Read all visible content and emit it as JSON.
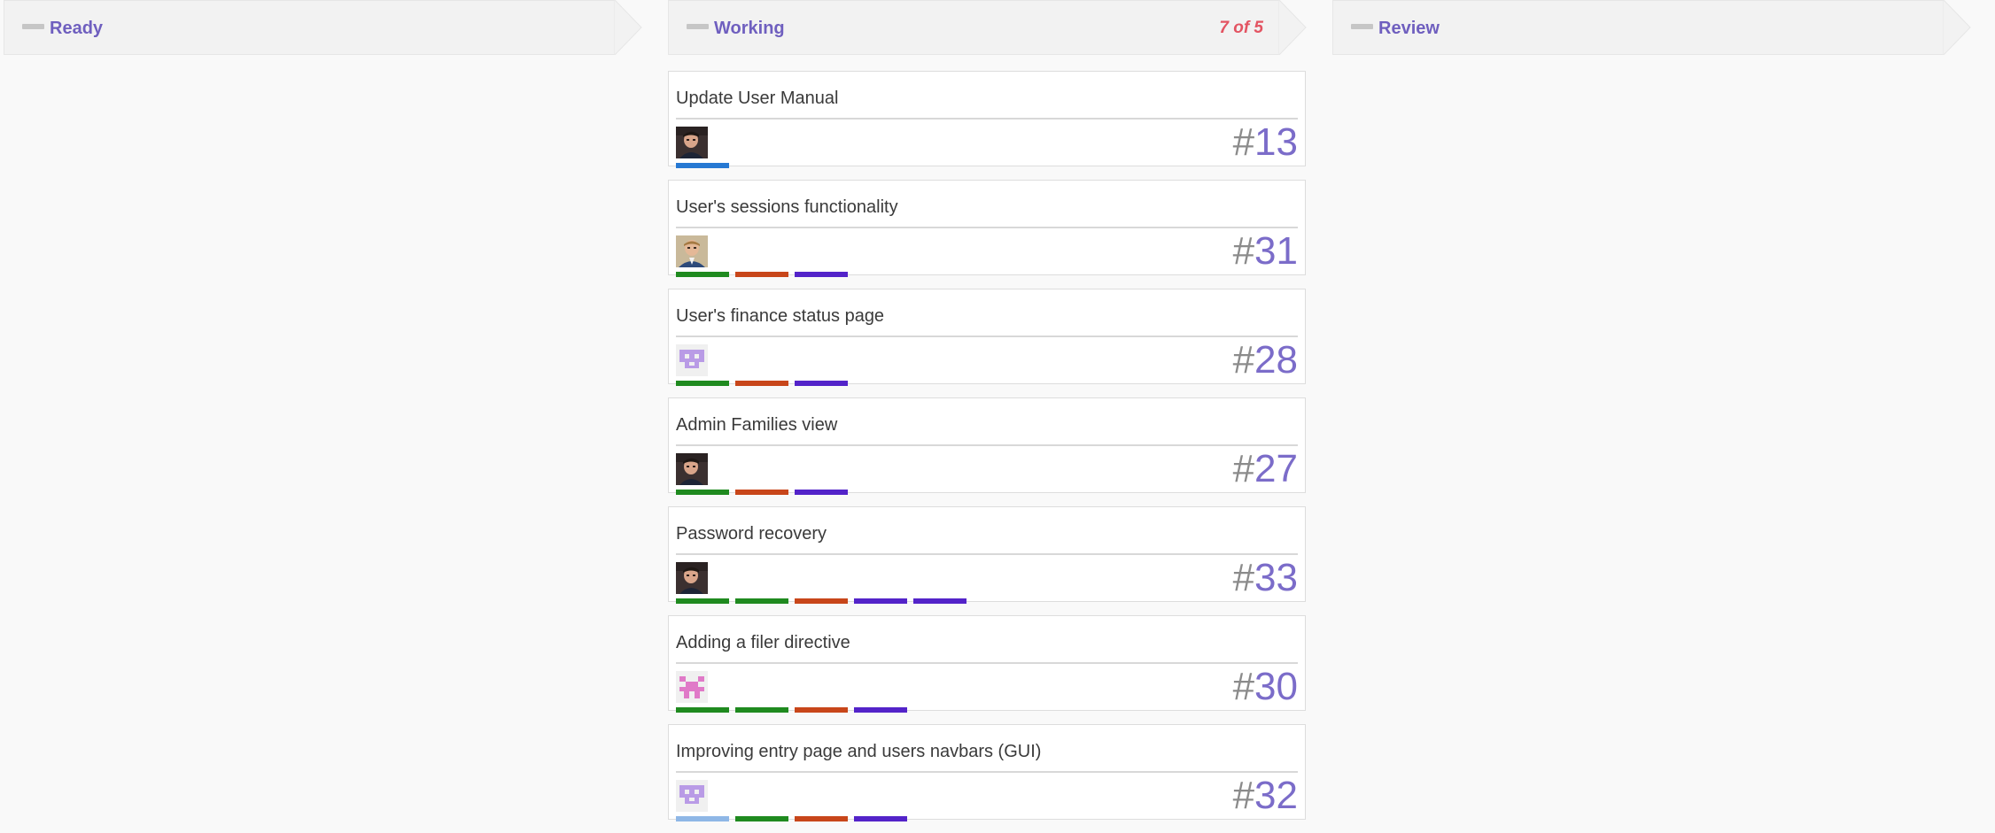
{
  "columns": [
    {
      "title": "Ready",
      "count": ""
    },
    {
      "title": "Working",
      "count": "7 of 5"
    },
    {
      "title": "Review",
      "count": ""
    }
  ],
  "colors": {
    "green": "#1f8a1f",
    "orange": "#c8461a",
    "purple": "#5323c9",
    "blue": "#2779d3",
    "lightblue": "#8fb7e6",
    "accent": "#6f5fbf",
    "count": "#e35462"
  },
  "cards": [
    {
      "title": "Update User Manual",
      "hash": "#",
      "number": "13",
      "avatar": "photo-man-dark",
      "tags": [
        "blue"
      ]
    },
    {
      "title": "User's sessions functionality",
      "hash": "#",
      "number": "31",
      "avatar": "photo-man-light",
      "tags": [
        "green",
        "orange",
        "purple"
      ]
    },
    {
      "title": "User's finance status page",
      "hash": "#",
      "number": "28",
      "avatar": "identicon-purple",
      "tags": [
        "green",
        "orange",
        "purple"
      ]
    },
    {
      "title": "Admin Families view",
      "hash": "#",
      "number": "27",
      "avatar": "photo-man-dark",
      "tags": [
        "green",
        "orange",
        "purple"
      ]
    },
    {
      "title": "Password recovery",
      "hash": "#",
      "number": "33",
      "avatar": "photo-man-dark",
      "tags": [
        "green",
        "green",
        "orange",
        "purple",
        "purple"
      ]
    },
    {
      "title": "Adding a filer directive",
      "hash": "#",
      "number": "30",
      "avatar": "identicon-pink",
      "tags": [
        "green",
        "green",
        "orange",
        "purple"
      ]
    },
    {
      "title": "Improving entry page and users navbars (GUI)",
      "hash": "#",
      "number": "32",
      "avatar": "identicon-purple",
      "tags": [
        "lightblue",
        "green",
        "orange",
        "purple"
      ]
    }
  ]
}
